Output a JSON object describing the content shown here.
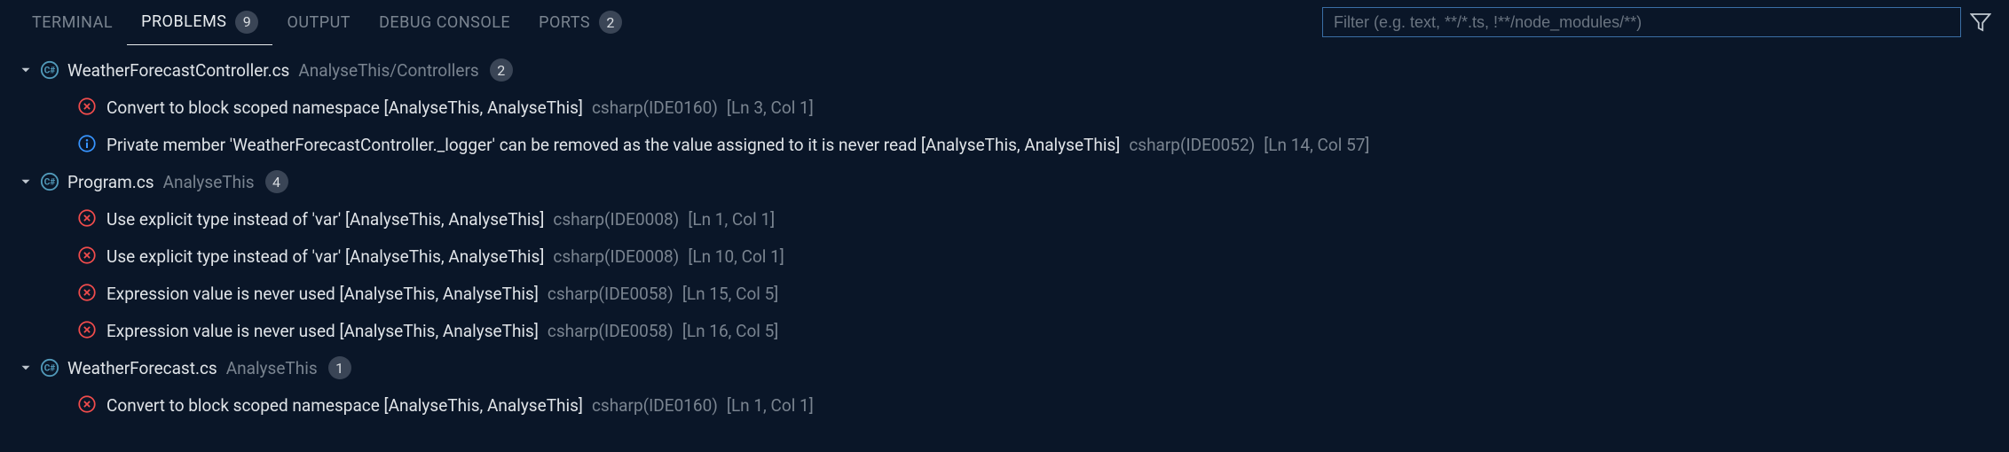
{
  "tabs": {
    "terminal": "TERMINAL",
    "problems": "PROBLEMS",
    "problems_count": "9",
    "output": "OUTPUT",
    "debug_console": "DEBUG CONSOLE",
    "ports": "PORTS",
    "ports_count": "2"
  },
  "filter": {
    "placeholder": "Filter (e.g. text, **/*.ts, !**/node_modules/**)"
  },
  "files": [
    {
      "name": "WeatherForecastController.cs",
      "path": "AnalyseThis/Controllers",
      "count": "2",
      "problems": [
        {
          "sev": "error",
          "msg": "Convert to block scoped namespace [AnalyseThis, AnalyseThis]",
          "src": "csharp(IDE0160)",
          "loc": "[Ln 3, Col 1]"
        },
        {
          "sev": "info",
          "msg": "Private member 'WeatherForecastController._logger' can be removed as the value assigned to it is never read [AnalyseThis, AnalyseThis]",
          "src": "csharp(IDE0052)",
          "loc": "[Ln 14, Col 57]"
        }
      ]
    },
    {
      "name": "Program.cs",
      "path": "AnalyseThis",
      "count": "4",
      "problems": [
        {
          "sev": "error",
          "msg": "Use explicit type instead of 'var' [AnalyseThis, AnalyseThis]",
          "src": "csharp(IDE0008)",
          "loc": "[Ln 1, Col 1]"
        },
        {
          "sev": "error",
          "msg": "Use explicit type instead of 'var' [AnalyseThis, AnalyseThis]",
          "src": "csharp(IDE0008)",
          "loc": "[Ln 10, Col 1]"
        },
        {
          "sev": "error",
          "msg": "Expression value is never used [AnalyseThis, AnalyseThis]",
          "src": "csharp(IDE0058)",
          "loc": "[Ln 15, Col 5]"
        },
        {
          "sev": "error",
          "msg": "Expression value is never used [AnalyseThis, AnalyseThis]",
          "src": "csharp(IDE0058)",
          "loc": "[Ln 16, Col 5]"
        }
      ]
    },
    {
      "name": "WeatherForecast.cs",
      "path": "AnalyseThis",
      "count": "1",
      "problems": [
        {
          "sev": "error",
          "msg": "Convert to block scoped namespace [AnalyseThis, AnalyseThis]",
          "src": "csharp(IDE0160)",
          "loc": "[Ln 1, Col 1]"
        }
      ]
    }
  ]
}
